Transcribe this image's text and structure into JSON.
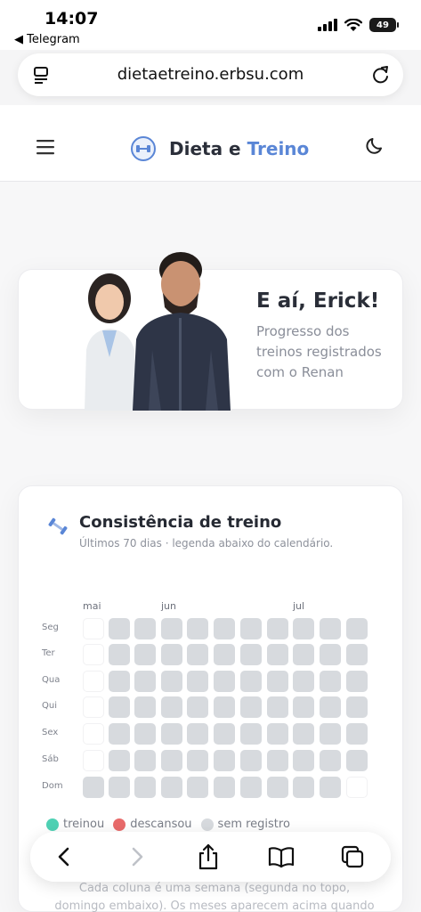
{
  "status": {
    "time": "14:07",
    "back_app": "◀ Telegram",
    "battery": "49"
  },
  "browser": {
    "url": "dietaetreino.erbsu.com"
  },
  "header": {
    "brand_prefix": "Dieta e ",
    "brand_accent": "Treino",
    "accent_color": "#5a86d6"
  },
  "hero": {
    "greeting": "E aí, Erick!",
    "subtitle": "Progresso dos treinos registrados com o Renan"
  },
  "consistency": {
    "title": "Consistência de treino",
    "subtitle": "Últimos 70 dias · legenda abaixo do calendário.",
    "months": [
      "mai",
      "jun",
      "jul"
    ],
    "days": [
      "Seg",
      "Ter",
      "Qua",
      "Qui",
      "Sex",
      "Sáb",
      "Dom"
    ],
    "legend": [
      {
        "label": "treinou",
        "color": "#4fd1b4"
      },
      {
        "label": "descansou",
        "color": "#e86a6a"
      },
      {
        "label": "sem registro",
        "color": "#d7dade"
      }
    ],
    "note": "Cada coluna é uma semana (segunda no topo, domingo embaixo). Os meses aparecem acima quando"
  },
  "icons": [
    "tabs-icon",
    "reload-icon",
    "menu-icon",
    "dumbbell-icon",
    "moon-icon",
    "back-icon",
    "forward-icon",
    "share-icon",
    "bookmarks-icon",
    "tabs-overview-icon"
  ]
}
